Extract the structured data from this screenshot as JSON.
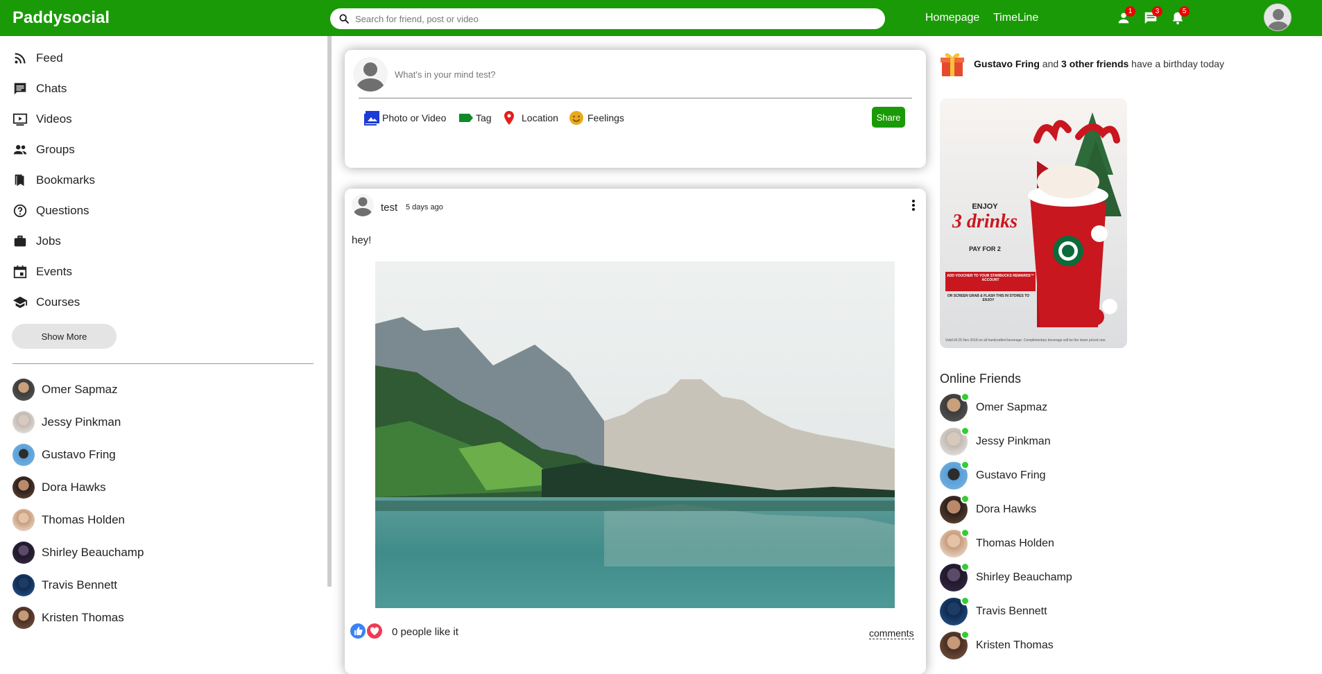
{
  "topbar": {
    "logo": "Paddysocial",
    "search_placeholder": "Search for friend, post or video",
    "links": [
      "Homepage",
      "TimeLine"
    ],
    "badges": {
      "friends": "1",
      "messages": "3",
      "notifications": "5"
    }
  },
  "sidebar": {
    "items": [
      {
        "label": "Feed",
        "icon": "rss-icon"
      },
      {
        "label": "Chats",
        "icon": "chat-icon"
      },
      {
        "label": "Videos",
        "icon": "video-icon"
      },
      {
        "label": "Groups",
        "icon": "group-icon"
      },
      {
        "label": "Bookmarks",
        "icon": "bookmark-icon"
      },
      {
        "label": "Questions",
        "icon": "question-icon"
      },
      {
        "label": "Jobs",
        "icon": "briefcase-icon"
      },
      {
        "label": "Events",
        "icon": "calendar-icon"
      },
      {
        "label": "Courses",
        "icon": "school-icon"
      }
    ],
    "show_more": "Show More",
    "friends": [
      "Omer Sapmaz",
      "Jessy Pinkman",
      "Gustavo Fring",
      "Dora Hawks",
      "Thomas Holden",
      "Shirley Beauchamp",
      "Travis Bennett",
      "Kristen Thomas"
    ]
  },
  "share": {
    "placeholder": "What's in your mind test?",
    "options": [
      "Photo or Video",
      "Tag",
      "Location",
      "Feelings"
    ],
    "button": "Share"
  },
  "post": {
    "user": "test",
    "time": "5 days ago",
    "text": "hey!",
    "likes": "0 people like it",
    "comments": "comments"
  },
  "rightbar": {
    "birthday_name": "Gustavo Fring",
    "birthday_and": " and ",
    "birthday_others": "3 other friends",
    "birthday_tail": " have a birthday today",
    "ad": {
      "line1": "ENJOY",
      "line2": "3 drinks",
      "line3": "PAY FOR 2",
      "line4": "ADD VOUCHER TO YOUR STARBUCKS REWARDS™ ACCOUNT",
      "line5": "OR SCREEN GRAB & FLASH THIS IN STORES TO ENJOY"
    },
    "online_title": "Online Friends",
    "online_friends": [
      "Omer Sapmaz",
      "Jessy Pinkman",
      "Gustavo Fring",
      "Dora Hawks",
      "Thomas Holden",
      "Shirley Beauchamp",
      "Travis Bennett",
      "Kristen Thomas"
    ]
  },
  "colors": {
    "brand": "#1a9a07",
    "badge": "#ee0000",
    "online": "#32cd32"
  }
}
